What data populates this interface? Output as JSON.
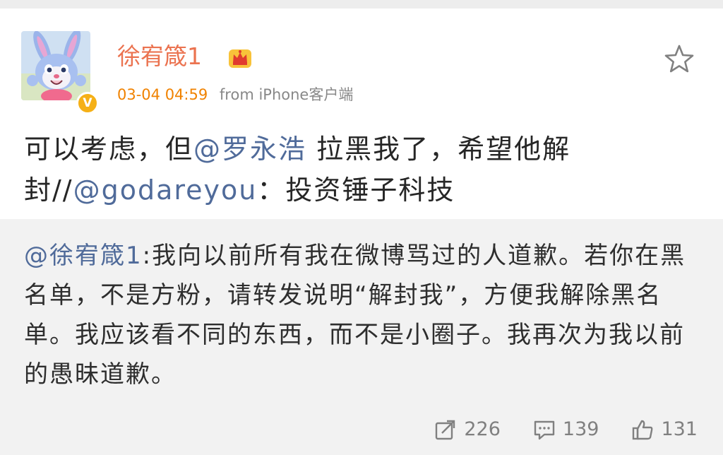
{
  "post": {
    "author": {
      "name": "徐宥箴1",
      "avatar_icon": "bunny-avatar",
      "verified_badge": "V",
      "member_icon": "crown-icon"
    },
    "time": "03-04 04:59",
    "source": "from iPhone客户端",
    "favorite_icon": "star-icon",
    "text": {
      "part1": "可以考虑，但",
      "mention1": "@罗永浩",
      "part2": " 拉黑我了，希望他解封//",
      "mention2": "@godareyou",
      "part3": "：投资锤子科技"
    }
  },
  "repost": {
    "mention": "@徐宥箴1",
    "text": ":我向以前所有我在微博骂过的人道歉。若你在黑名单，不是方粉，请转发说明“解封我”，方便我解除黑名单。我应该看不同的东西，而不是小圈子。我再次为我以前的愚昧道歉。",
    "stats": {
      "reposts": "226",
      "comments": "139",
      "likes": "131"
    }
  },
  "colors": {
    "username": "#eb7350",
    "time": "#f08200",
    "mention": "#506b9a",
    "repost_bg": "#f2f2f2",
    "badge": "#f5b016"
  }
}
